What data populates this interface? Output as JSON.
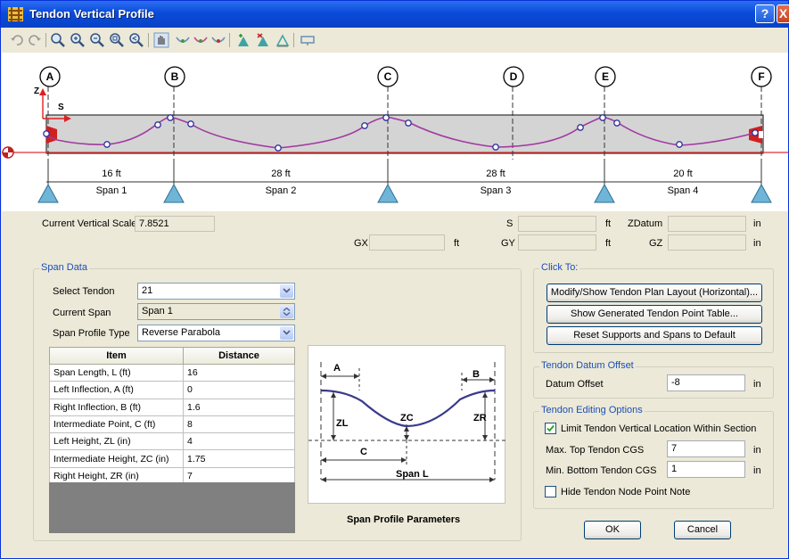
{
  "window": {
    "title": "Tendon Vertical Profile",
    "help": "?",
    "close": "X"
  },
  "toolbar": {
    "icons": [
      "undo-icon",
      "redo-icon",
      "zoom-window-icon",
      "zoom-in-icon",
      "zoom-out-icon",
      "zoom-fit-icon",
      "zoom-previous-icon",
      "pan-icon",
      "view-front-icon",
      "view-top-icon",
      "view-bottom-icon",
      "add-point-icon",
      "delete-point-icon",
      "move-point-icon",
      "display-options-icon"
    ]
  },
  "diagram": {
    "gridlines": [
      "A",
      "B",
      "C",
      "D",
      "E",
      "F"
    ],
    "axis_z": "Z",
    "axis_s": "S",
    "spans": [
      {
        "length": "16 ft",
        "name": "Span 1"
      },
      {
        "length": "28 ft",
        "name": "Span 2"
      },
      {
        "length": "28 ft",
        "name": "Span 3"
      },
      {
        "length": "20 ft",
        "name": "Span 4"
      }
    ]
  },
  "readouts": {
    "current_vertical_scale_label": "Current Vertical Scale",
    "current_vertical_scale": "7.8521",
    "s_label": "S",
    "s_value": "",
    "s_unit": "ft",
    "zdatum_label": "ZDatum",
    "zdatum_value": "",
    "zdatum_unit": "in",
    "gx_label": "GX",
    "gx_value": "",
    "gx_unit": "ft",
    "gy_label": "GY",
    "gy_value": "",
    "gy_unit": "ft",
    "gz_label": "GZ",
    "gz_value": "",
    "gz_unit": "in"
  },
  "span_data": {
    "title": "Span Data",
    "select_tendon_label": "Select Tendon",
    "select_tendon": "21",
    "current_span_label": "Current Span",
    "current_span": "Span 1",
    "profile_type_label": "Span Profile Type",
    "profile_type": "Reverse Parabola",
    "table": {
      "headers": [
        "Item",
        "Distance"
      ],
      "rows": [
        [
          "Span Length, L  (ft)",
          "16"
        ],
        [
          "Left Inflection, A  (ft)",
          "0"
        ],
        [
          "Right Inflection, B  (ft)",
          "1.6"
        ],
        [
          "Intermediate Point, C  (ft)",
          "8"
        ],
        [
          "Left Height, ZL  (in)",
          "4"
        ],
        [
          "Intermediate Height, ZC  (in)",
          "1.75"
        ],
        [
          "Right Height, ZR  (in)",
          "7"
        ]
      ]
    },
    "figure_labels": {
      "a": "A",
      "b": "B",
      "zl": "ZL",
      "zc": "ZC",
      "zr": "ZR",
      "c": "C",
      "span": "Span L"
    },
    "figure_caption": "Span Profile Parameters"
  },
  "click_to": {
    "title": "Click To:",
    "buttons": [
      "Modify/Show Tendon Plan Layout (Horizontal)...",
      "Show Generated Tendon Point Table...",
      "Reset Supports and Spans to Default"
    ]
  },
  "datum_offset": {
    "title": "Tendon Datum Offset",
    "label": "Datum Offset",
    "value": "-8",
    "unit": "in"
  },
  "editing_options": {
    "title": "Tendon Editing Options",
    "limit_label": "Limit Tendon Vertical Location Within Section",
    "limit_checked": true,
    "max_top_label": "Max. Top Tendon CGS",
    "max_top_value": "7",
    "max_top_unit": "in",
    "min_bottom_label": "Min. Bottom Tendon CGS",
    "min_bottom_value": "1",
    "min_bottom_unit": "in",
    "hide_label": "Hide Tendon Node Point Note",
    "hide_checked": false
  },
  "actions": {
    "ok": "OK",
    "cancel": "Cancel"
  }
}
